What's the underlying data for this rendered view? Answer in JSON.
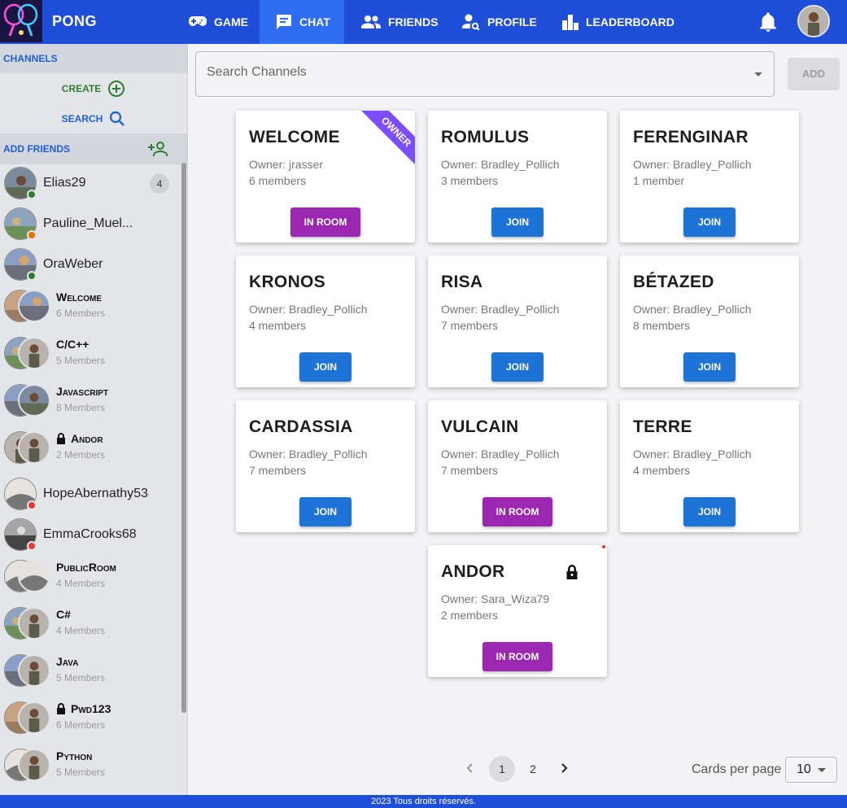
{
  "app": {
    "title": "PONG"
  },
  "nav": [
    {
      "label": "GAME",
      "icon": "gamepad-icon",
      "active": false
    },
    {
      "label": "CHAT",
      "icon": "chat-icon",
      "active": true
    },
    {
      "label": "FRIENDS",
      "icon": "people-icon",
      "active": false
    },
    {
      "label": "PROFILE",
      "icon": "profile-search-icon",
      "active": false
    },
    {
      "label": "LEADERBOARD",
      "icon": "leaderboard-icon",
      "active": false
    }
  ],
  "sidebar": {
    "channels_label": "CHANNELS",
    "create_label": "CREATE",
    "search_label": "SEARCH",
    "add_friends_label": "ADD FRIENDS",
    "items": [
      {
        "type": "user",
        "name": "Elias29",
        "status": "online",
        "badge": "4"
      },
      {
        "type": "user",
        "name": "Pauline_Muel...",
        "status": "away"
      },
      {
        "type": "user",
        "name": "OraWeber",
        "status": "online"
      },
      {
        "type": "channel",
        "name": "Welcome",
        "members": "6 Members",
        "locked": false
      },
      {
        "type": "channel",
        "name": "C/C++",
        "members": "5 Members",
        "locked": false
      },
      {
        "type": "channel",
        "name": "Javascript",
        "members": "8 Members",
        "locked": false
      },
      {
        "type": "channel",
        "name": "Andor",
        "members": "2 Members",
        "locked": true
      },
      {
        "type": "user",
        "name": "HopeAbernathy53",
        "status": "busy"
      },
      {
        "type": "user",
        "name": "EmmaCrooks68",
        "status": "busy"
      },
      {
        "type": "channel",
        "name": "PublicRoom",
        "members": "4 Members",
        "locked": false
      },
      {
        "type": "channel",
        "name": "C#",
        "members": "4 Members",
        "locked": false
      },
      {
        "type": "channel",
        "name": "Java",
        "members": "5 Members",
        "locked": false
      },
      {
        "type": "channel",
        "name": "Pwd123",
        "members": "6 Members",
        "locked": true
      },
      {
        "type": "channel",
        "name": "Python",
        "members": "5 Members",
        "locked": false
      }
    ]
  },
  "search": {
    "placeholder": "Search Channels",
    "add_label": "ADD"
  },
  "cards": [
    {
      "title": "WELCOME",
      "owner": "Owner: jrasser",
      "members": "6 members",
      "action": "IN ROOM",
      "ribbon": "OWNER"
    },
    {
      "title": "ROMULUS",
      "owner": "Owner: Bradley_Pollich",
      "members": "3 members",
      "action": "JOIN"
    },
    {
      "title": "FERENGINAR",
      "owner": "Owner: Bradley_Pollich",
      "members": "1 member",
      "action": "JOIN"
    },
    {
      "title": "KRONOS",
      "owner": "Owner: Bradley_Pollich",
      "members": "4 members",
      "action": "JOIN"
    },
    {
      "title": "RISA",
      "owner": "Owner: Bradley_Pollich",
      "members": "7 members",
      "action": "JOIN"
    },
    {
      "title": "BÉTAZED",
      "owner": "Owner: Bradley_Pollich",
      "members": "8 members",
      "action": "JOIN"
    },
    {
      "title": "CARDASSIA",
      "owner": "Owner: Bradley_Pollich",
      "members": "7 members",
      "action": "JOIN"
    },
    {
      "title": "VULCAIN",
      "owner": "Owner: Bradley_Pollich",
      "members": "7 members",
      "action": "IN ROOM"
    },
    {
      "title": "TERRE",
      "owner": "Owner: Bradley_Pollich",
      "members": "4 members",
      "action": "JOIN"
    },
    {
      "title": "ANDOR",
      "owner": "Owner: Sara_Wiza79",
      "members": "2 members",
      "action": "IN ROOM",
      "locked": true
    }
  ],
  "pagination": {
    "pages": [
      "1",
      "2"
    ],
    "current": "1",
    "cards_per_page_label": "Cards per page",
    "cards_per_page": "10"
  },
  "footer": {
    "text": "2023 Tous droits réservés."
  },
  "colors": {
    "primary": "#1f4ed8",
    "active_tab": "#2f6df2",
    "join": "#1e73d6",
    "in_room": "#9c27b0",
    "ribbon": "#7c4dff"
  }
}
